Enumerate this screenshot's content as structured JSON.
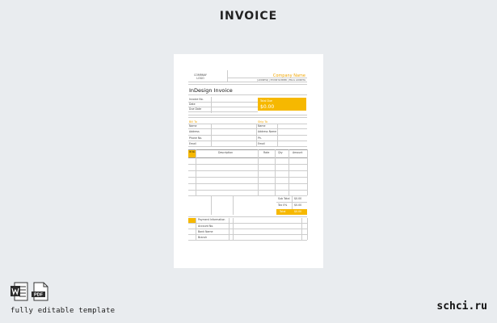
{
  "page": {
    "title": "INVOICE",
    "footer_text": "fully editable template",
    "brand": "schci.ru"
  },
  "icons": {
    "word": "word-file-icon",
    "pdf": "pdf-file-icon",
    "pdf_label": "PDF"
  },
  "colors": {
    "accent": "#f6b800",
    "background": "#e9ecef",
    "paper": "#ffffff"
  },
  "invoice": {
    "logo_label": "COMPANY LOGO",
    "company_name": "Company Name",
    "company_contact": "[ADDRESS] | PHONE NUMBER | EMAIL ADDRESS",
    "doc_title": "InDesign Invoice",
    "meta_labels": [
      "Invoice No.",
      "Date",
      "Due Date"
    ],
    "total_due_label": "Total Due",
    "total_due_amount": "$0.00",
    "bill_to": {
      "heading": "Bill To",
      "fields": [
        "Name",
        "Address",
        "Phone No.",
        "Email"
      ]
    },
    "ship_to": {
      "heading": "Ship To",
      "fields": [
        "Name",
        "Address Name",
        "Ph.",
        "Email"
      ]
    },
    "table": {
      "num_header": "ID No.",
      "columns": [
        "Description",
        "Rate",
        "Qty",
        "Amount"
      ]
    },
    "totals": {
      "labels": [
        "Sub Total",
        "Tax 0%",
        "Total"
      ],
      "values": [
        "$0.00",
        "$0.00",
        "$0.00"
      ]
    },
    "payment": {
      "heading": "Payment Information",
      "fields": [
        "Account No.",
        "Bank Name",
        "Branch"
      ]
    }
  }
}
